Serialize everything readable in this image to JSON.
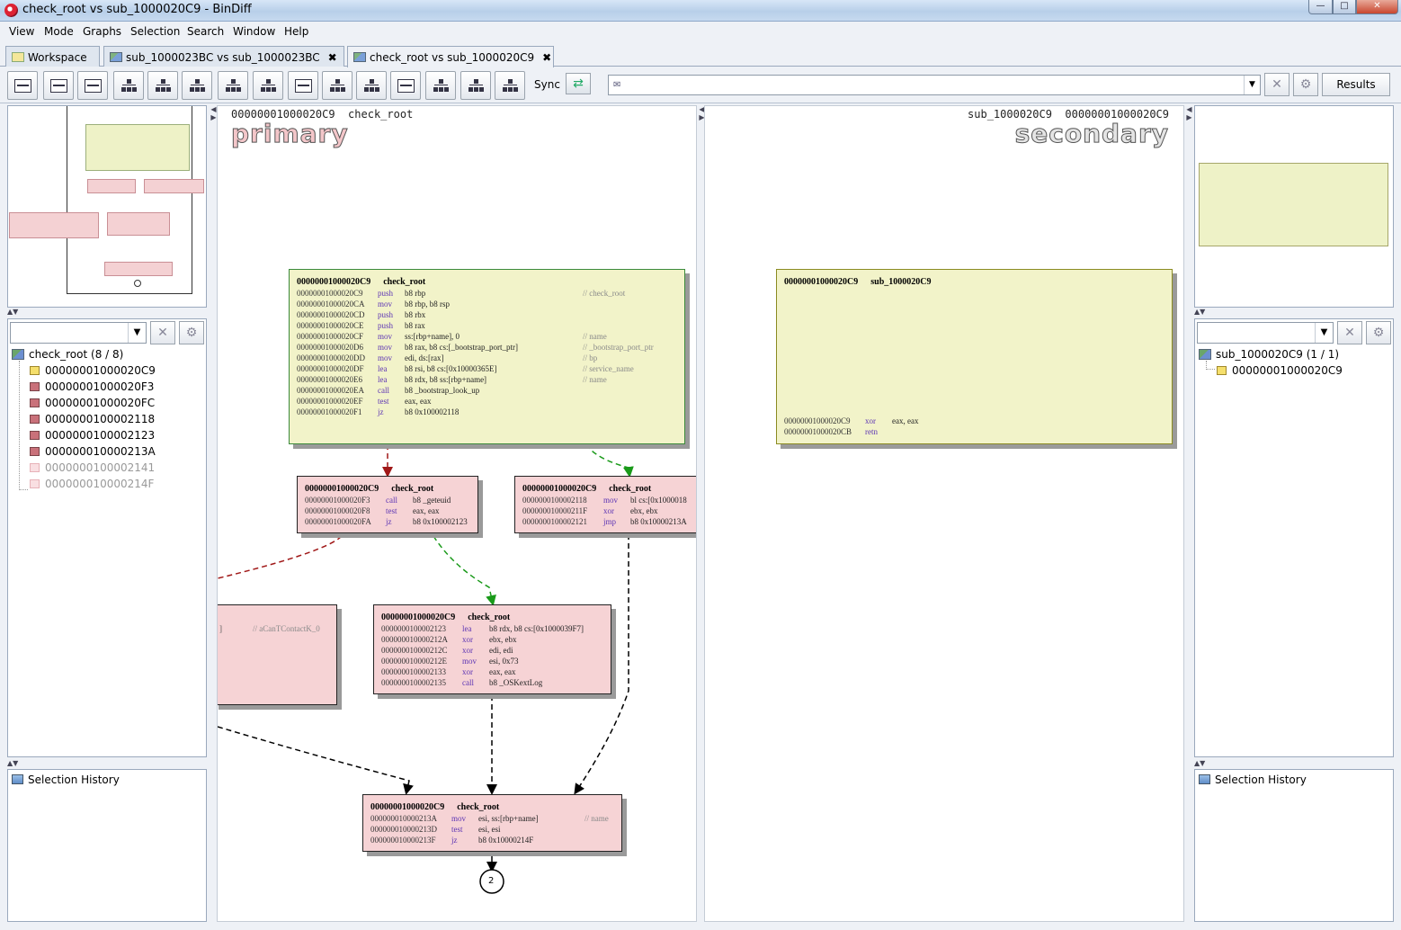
{
  "window": {
    "title": "check_root vs sub_1000020C9 - BinDiff",
    "min": "—",
    "max": "□",
    "close": "✕"
  },
  "menu": [
    "View",
    "Mode",
    "Graphs",
    "Selection",
    "Search",
    "Window",
    "Help"
  ],
  "tabs": [
    {
      "label": "Workspace"
    },
    {
      "label": "sub_1000023BC vs sub_1000023BC",
      "close": "✖"
    },
    {
      "label": "check_root vs sub_1000020C9",
      "close": "✖"
    }
  ],
  "toolbar": {
    "sync_label": "Sync",
    "results_label": "Results",
    "clear": "✕",
    "settings": "⚙",
    "flag": "✉"
  },
  "left_tree": {
    "root": "check_root (8 / 8)",
    "items": [
      "00000001000020C9",
      "00000001000020F3",
      "00000001000020FC",
      "0000000100002118",
      "0000000100002123",
      "000000010000213A",
      "0000000100002141",
      "000000010000214F"
    ],
    "history": "Selection History"
  },
  "right_tree": {
    "root": "sub_1000020C9 (1 / 1)",
    "items": [
      "00000001000020C9"
    ],
    "history": "Selection History"
  },
  "primary": {
    "header_addr": "00000001000020C9",
    "header_name": "check_root",
    "label": "primary",
    "nodes": {
      "n1": {
        "addr": "00000001000020C9",
        "name": "check_root",
        "rows": [
          {
            "a": "00000001000020C9",
            "m": "push",
            "o": "b8 rbp",
            "c": "// check_root"
          },
          {
            "a": "00000001000020CA",
            "m": "mov",
            "o": "b8 rbp, b8 rsp",
            "c": ""
          },
          {
            "a": "00000001000020CD",
            "m": "push",
            "o": "b8 rbx",
            "c": ""
          },
          {
            "a": "00000001000020CE",
            "m": "push",
            "o": "b8 rax",
            "c": ""
          },
          {
            "a": "00000001000020CF",
            "m": "mov",
            "o": "ss:[rbp+name], 0",
            "c": "// name"
          },
          {
            "a": "00000001000020D6",
            "m": "mov",
            "o": "b8 rax, b8 cs:[_bootstrap_port_ptr]",
            "c": "// _bootstrap_port_ptr"
          },
          {
            "a": "00000001000020DD",
            "m": "mov",
            "o": "edi, ds:[rax]",
            "c": "// bp"
          },
          {
            "a": "00000001000020DF",
            "m": "lea",
            "o": "b8 rsi, b8 cs:[0x10000365E]",
            "c": "// service_name"
          },
          {
            "a": "00000001000020E6",
            "m": "lea",
            "o": "b8 rdx, b8 ss:[rbp+name]",
            "c": "// name"
          },
          {
            "a": "00000001000020EA",
            "m": "call",
            "o": "b8 _bootstrap_look_up",
            "c": ""
          },
          {
            "a": "00000001000020EF",
            "m": "test",
            "o": "eax, eax",
            "c": ""
          },
          {
            "a": "00000001000020F1",
            "m": "jz",
            "o": "b8 0x100002118",
            "c": ""
          }
        ]
      },
      "n2": {
        "addr": "00000001000020C9",
        "name": "check_root",
        "rows": [
          {
            "a": "00000001000020F3",
            "m": "call",
            "o": "b8 _geteuid",
            "c": ""
          },
          {
            "a": "00000001000020F8",
            "m": "test",
            "o": "eax, eax",
            "c": ""
          },
          {
            "a": "00000001000020FA",
            "m": "jz",
            "o": "b8 0x100002123",
            "c": ""
          }
        ]
      },
      "n3": {
        "addr": "00000001000020C9",
        "name": "check_root",
        "rows": [
          {
            "a": "0000000100002118",
            "m": "mov",
            "o": "bl cs:[0x1000018",
            "c": ""
          },
          {
            "a": "000000010000211F",
            "m": "xor",
            "o": "ebx, ebx",
            "c": ""
          },
          {
            "a": "0000000100002121",
            "m": "jmp",
            "o": "b8 0x10000213A",
            "c": ""
          }
        ]
      },
      "n4": {
        "comment": "// aCanTContactK_0",
        "bracket": "]"
      },
      "n5": {
        "addr": "00000001000020C9",
        "name": "check_root",
        "rows": [
          {
            "a": "0000000100002123",
            "m": "lea",
            "o": "b8 rdx, b8 cs:[0x1000039F7]",
            "c": ""
          },
          {
            "a": "000000010000212A",
            "m": "xor",
            "o": "ebx, ebx",
            "c": ""
          },
          {
            "a": "000000010000212C",
            "m": "xor",
            "o": "edi, edi",
            "c": ""
          },
          {
            "a": "000000010000212E",
            "m": "mov",
            "o": "esi, 0x73",
            "c": ""
          },
          {
            "a": "0000000100002133",
            "m": "xor",
            "o": "eax, eax",
            "c": ""
          },
          {
            "a": "0000000100002135",
            "m": "call",
            "o": "b8 _OSKextLog",
            "c": ""
          }
        ]
      },
      "n6": {
        "addr": "00000001000020C9",
        "name": "check_root",
        "rows": [
          {
            "a": "000000010000213A",
            "m": "mov",
            "o": "esi, ss:[rbp+name]",
            "c": "// name"
          },
          {
            "a": "000000010000213D",
            "m": "test",
            "o": "esi, esi",
            "c": ""
          },
          {
            "a": "000000010000213F",
            "m": "jz",
            "o": "b8 0x10000214F",
            "c": ""
          }
        ]
      }
    },
    "collapsed_count": "2"
  },
  "secondary": {
    "header_name": "sub_1000020C9",
    "header_addr": "00000001000020C9",
    "label": "secondary",
    "node": {
      "addr": "00000001000020C9",
      "name": "sub_1000020C9",
      "rows": [
        {
          "a": "00000001000020C9",
          "m": "xor",
          "o": "eax, eax",
          "c": ""
        },
        {
          "a": "00000001000020CB",
          "m": "retn",
          "o": "",
          "c": ""
        }
      ]
    }
  }
}
